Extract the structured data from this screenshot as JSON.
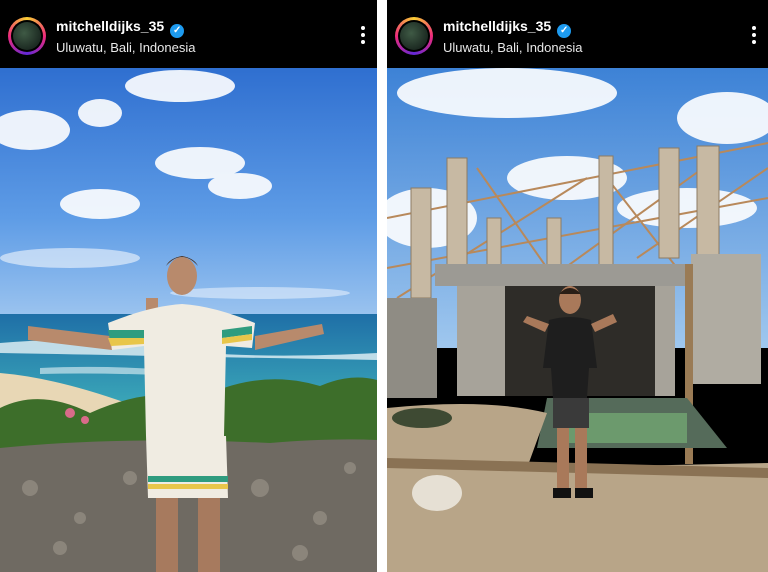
{
  "posts": [
    {
      "username": "mitchelldijks_35",
      "location": "Uluwatu, Bali, Indonesia",
      "photo_icon": "beach-cliff-photo"
    },
    {
      "username": "mitchelldijks_35",
      "location": "Uluwatu, Bali, Indonesia",
      "photo_icon": "construction-site-photo"
    }
  ],
  "colors": {
    "header_bg": "#000000",
    "verified_badge": "#1d9bf0",
    "divider": "#ffffff"
  }
}
